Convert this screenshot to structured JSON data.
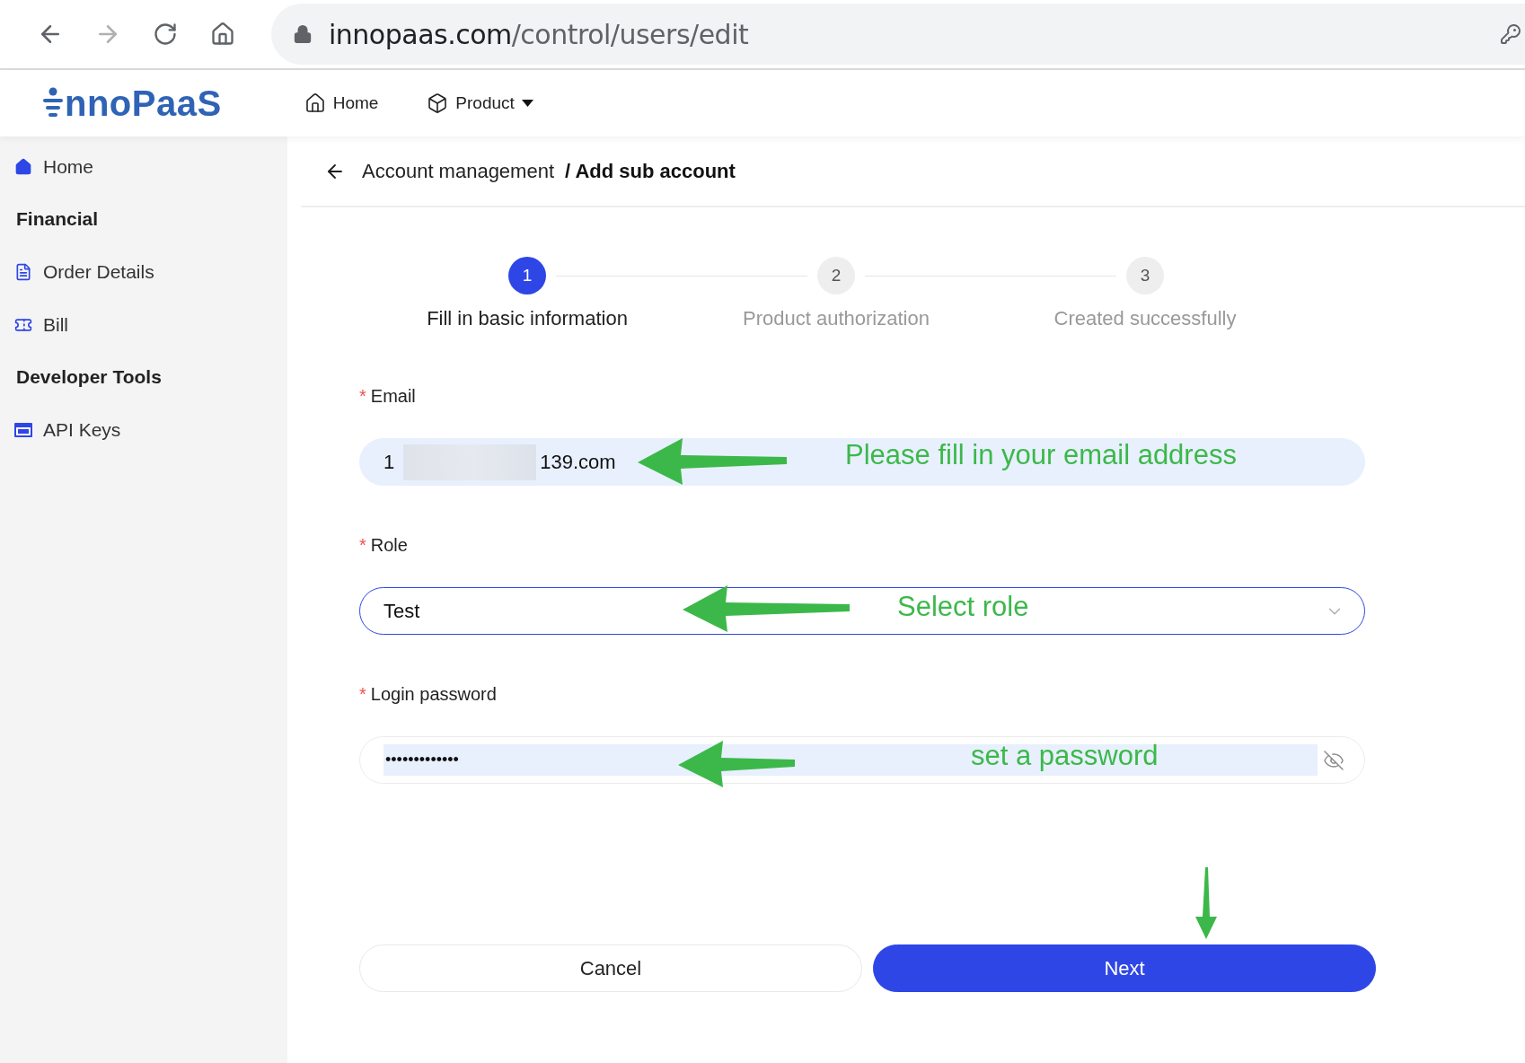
{
  "browser": {
    "url_host": "innopaas.com",
    "url_path": "/control/users/edit"
  },
  "header": {
    "logo": "nnoPaaS",
    "nav": [
      {
        "label": "Home",
        "dropdown": false
      },
      {
        "label": "Product",
        "dropdown": true
      }
    ]
  },
  "sidebar": {
    "items": [
      {
        "kind": "link",
        "label": "Home"
      },
      {
        "kind": "heading",
        "label": "Financial"
      },
      {
        "kind": "link",
        "label": "Order Details"
      },
      {
        "kind": "link",
        "label": "Bill"
      },
      {
        "kind": "heading",
        "label": "Developer Tools"
      },
      {
        "kind": "link",
        "label": "API Keys"
      }
    ]
  },
  "breadcrumb": {
    "parent": "Account management",
    "current": "/ Add sub account"
  },
  "steps": [
    {
      "number": "1",
      "label": "Fill in basic information",
      "selected": true
    },
    {
      "number": "2",
      "label": "Product authorization",
      "selected": false
    },
    {
      "number": "3",
      "label": "Created successfully",
      "selected": false
    }
  ],
  "fields": [
    {
      "kind": "email",
      "required_mark": "*",
      "label": "Email",
      "value_start": "1",
      "value_end": "139.com",
      "focused": false
    },
    {
      "kind": "select",
      "required_mark": "*",
      "label": "Role",
      "value": "Test",
      "focused": true
    },
    {
      "kind": "password",
      "required_mark": "*",
      "label": "Login password",
      "value": "•••••••••••••",
      "focused": false
    }
  ],
  "buttons": [
    {
      "kind": "secondary",
      "label": "Cancel"
    },
    {
      "kind": "primary",
      "label": "Next"
    }
  ],
  "annotations": [
    {
      "text": "Please fill in your email address"
    },
    {
      "text": "Select role"
    },
    {
      "text": "set a password"
    }
  ]
}
